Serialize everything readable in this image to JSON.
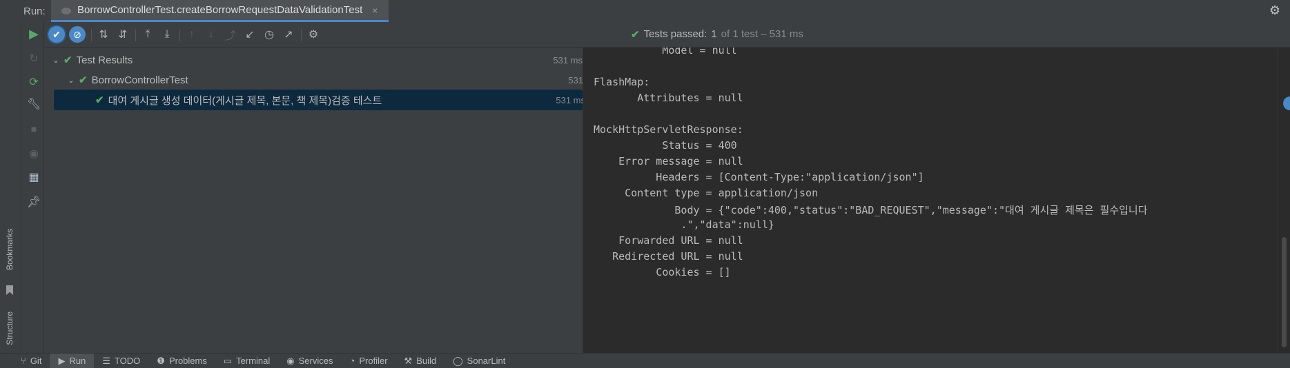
{
  "run_panel": {
    "label": "Run:",
    "tab_title": "BorrowControllerTest.createBorrowRequestDataValidationTest",
    "tab_close": "×",
    "settings": "⚙"
  },
  "status": {
    "text": "Tests passed:",
    "count": "1",
    "detail": "of 1 test – 531 ms",
    "color": "#59a869"
  },
  "tree": {
    "nodes": [
      {
        "label": "Test Results",
        "time": "531 ms"
      },
      {
        "label": "BorrowControllerTest",
        "time": "531 ms"
      },
      {
        "label": "대여 게시글 생성 데이터(게시글 제목, 본문, 책 제목)검증 테스트",
        "time": "531 ms"
      }
    ]
  },
  "console_lines": [
    "           Model = null",
    "",
    "FlashMap:",
    "       Attributes = null",
    "",
    "MockHttpServletResponse:",
    "           Status = 400",
    "    Error message = null",
    "          Headers = [Content-Type:\"application/json\"]",
    "     Content type = application/json",
    "             Body = {\"code\":400,\"status\":\"BAD_REQUEST\",\"message\":\"대여 게시글 제목은 필수입니다",
    "              .\",\"data\":null}",
    "    Forwarded URL = null",
    "   Redirected URL = null",
    "          Cookies = []"
  ],
  "side": {
    "bookmarks": "Bookmarks",
    "structure": "Structure"
  },
  "bottom_tabs": [
    {
      "icon": "git-icon",
      "glyph": "⑂",
      "label": "Git"
    },
    {
      "icon": "run-icon",
      "glyph": "▶",
      "label": "Run"
    },
    {
      "icon": "todo-icon",
      "glyph": "☰",
      "label": "TODO"
    },
    {
      "icon": "problems-icon",
      "glyph": "❶",
      "label": "Problems"
    },
    {
      "icon": "terminal-icon",
      "glyph": "▭",
      "label": "Terminal"
    },
    {
      "icon": "services-icon",
      "glyph": "◉",
      "label": "Services"
    },
    {
      "icon": "profiler-icon",
      "glyph": "◔",
      "label": "Profiler"
    },
    {
      "icon": "build-icon",
      "glyph": "⚒",
      "label": "Build"
    },
    {
      "icon": "sonarlint-icon",
      "glyph": "◯",
      "label": "SonarLint"
    }
  ]
}
